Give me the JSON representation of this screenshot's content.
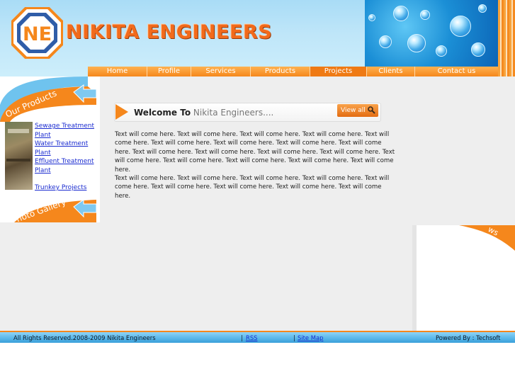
{
  "header": {
    "logo_letters": "NE",
    "brand": "NIKITA ENGINEERS"
  },
  "nav": {
    "items": [
      {
        "label": "Home",
        "width": 84
      },
      {
        "label": "Profile",
        "width": 62
      },
      {
        "label": "Services",
        "width": 84
      },
      {
        "label": "Products",
        "width": 84
      },
      {
        "label": "Projects",
        "width": 80
      },
      {
        "label": "Clients",
        "width": 68
      },
      {
        "label": "Contact us",
        "width": 104
      }
    ],
    "active_index": 4
  },
  "sidebar": {
    "products_heading": "Our Products",
    "product_links": [
      "Sewage Treatment Plant",
      "Water Treatment Plant",
      "Effluent Treatment Plant",
      "Trunkey Projects"
    ],
    "gallery_heading": "Photo Gallery"
  },
  "main": {
    "welcome_prefix": "Welcome To",
    "welcome_name": "Nikita Engineers....",
    "view_all": "View all",
    "paragraph1": "Text will come here. Text will come here. Text will come here. Text will come here. Text will come here. Text will come here. Text will come here. Text will come here. Text will come here. Text will come here. Text will come here. Text will come here. Text will come here. Text will come here. Text will come here. Text will come here. Text will come here. Text will come here.",
    "paragraph2": "Text will come here. Text will come here. Text will come here. Text will come here. Text will come here. Text will come here. Text will come here. Text will come here. Text will come here."
  },
  "news": {
    "heading_fragment": "ws"
  },
  "footer": {
    "copyright": "All Rights Reserved.2008-2009 Nikita Engineers",
    "sep": "|",
    "rss": "RSS",
    "sitemap": "Site Map",
    "powered": "Powered By : Techsoft"
  },
  "colors": {
    "accent_orange": "#f5871c",
    "link_blue": "#1a2bd0",
    "sky_blue": "#a9dcf6"
  }
}
